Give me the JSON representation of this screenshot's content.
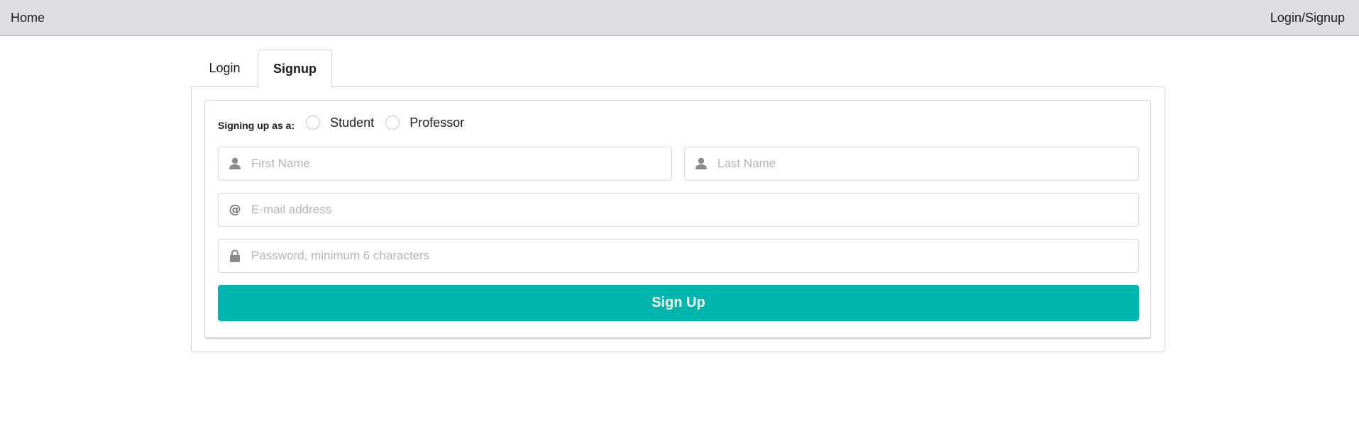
{
  "nav": {
    "home_label": "Home",
    "login_signup_label": "Login/Signup"
  },
  "tabs": [
    {
      "label": "Login",
      "active": false
    },
    {
      "label": "Signup",
      "active": true
    }
  ],
  "signup_form": {
    "role_label": "Signing up as a:",
    "roles": [
      {
        "label": "Student",
        "selected": false
      },
      {
        "label": "Professor",
        "selected": false
      }
    ],
    "first_name": {
      "value": "",
      "placeholder": "First Name",
      "icon": "user-icon"
    },
    "last_name": {
      "value": "",
      "placeholder": "Last Name",
      "icon": "user-icon"
    },
    "email": {
      "value": "",
      "placeholder": "E-mail address",
      "icon": "at-icon"
    },
    "password": {
      "value": "",
      "placeholder": "Password, minimum 6 characters",
      "icon": "lock-icon"
    },
    "submit_label": "Sign Up"
  },
  "colors": {
    "topbar_bg": "#dcdee2",
    "primary_button": "#00b5ad",
    "icon_gray": "#8a8a8a"
  }
}
